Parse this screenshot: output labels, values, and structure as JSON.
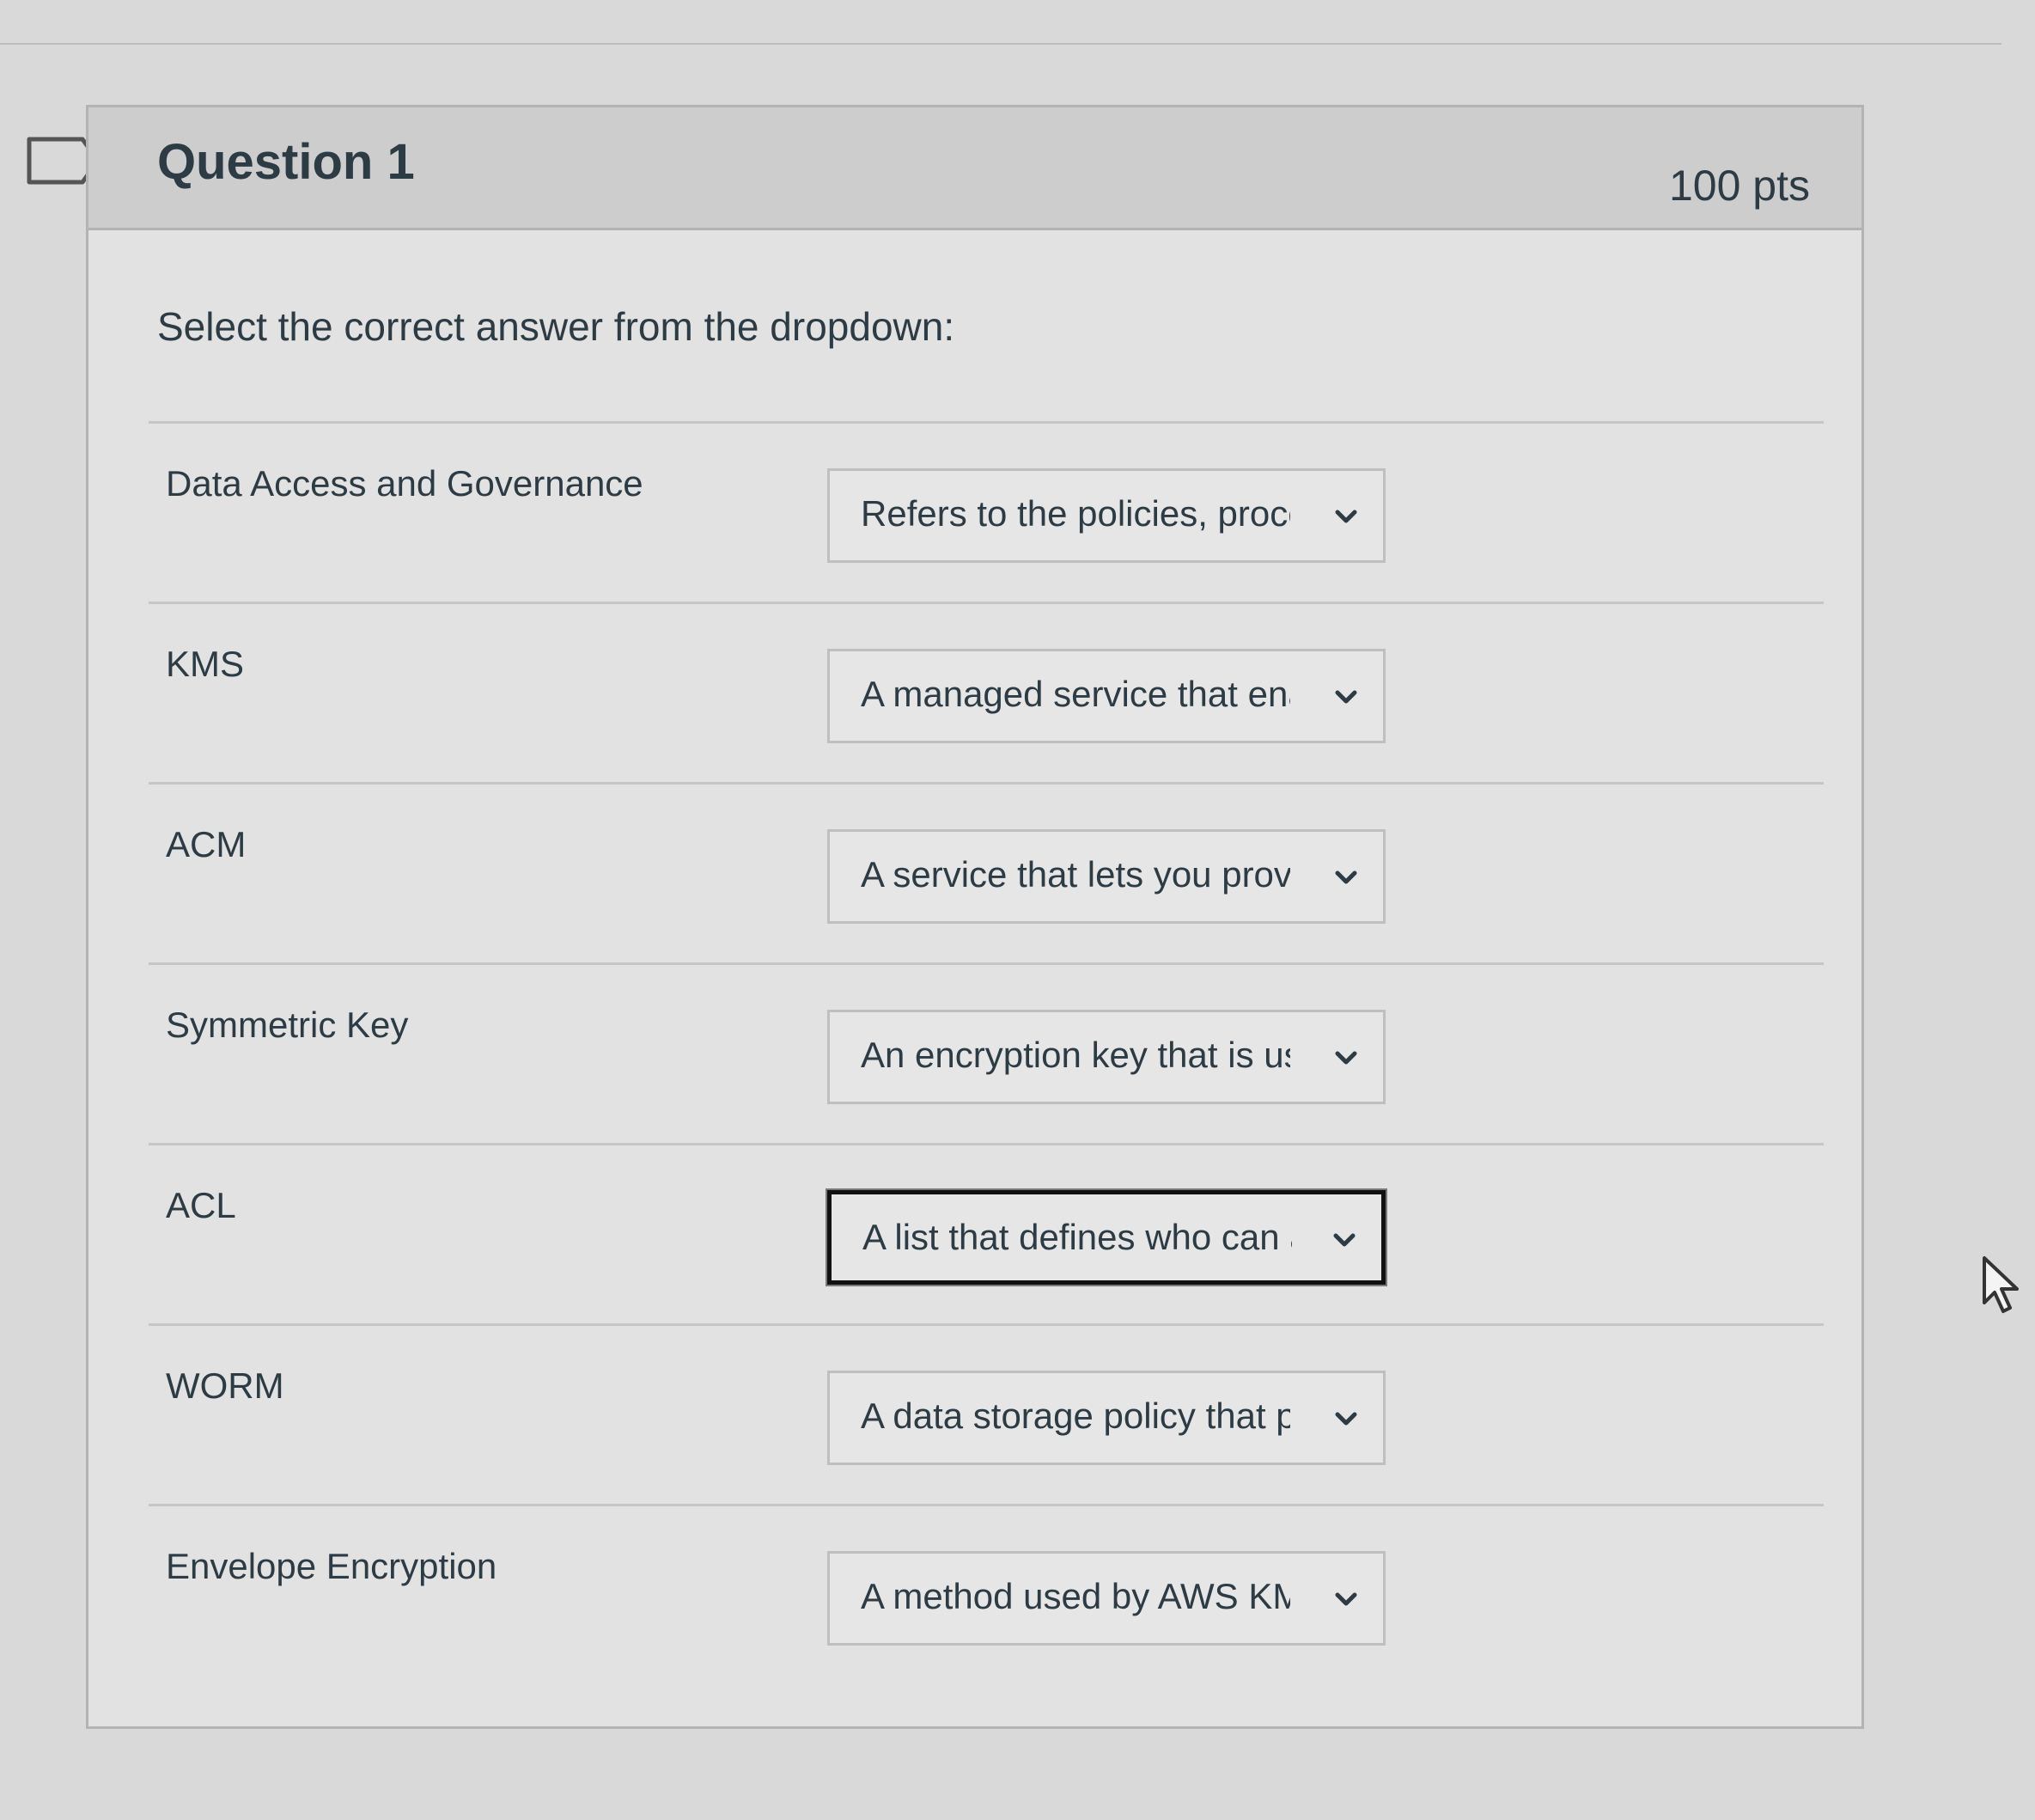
{
  "question": {
    "title": "Question 1",
    "points": "100 pts",
    "prompt": "Select the correct answer from the dropdown:"
  },
  "rows": [
    {
      "term": "Data Access and Governance",
      "selected": "Refers to the policies, procedures"
    },
    {
      "term": "KMS",
      "selected": "A managed service that enables"
    },
    {
      "term": "ACM",
      "selected": "A service that lets you provision"
    },
    {
      "term": "Symmetric Key",
      "selected": "An encryption key that is used"
    },
    {
      "term": "ACL",
      "selected": "A list that defines who can access"
    },
    {
      "term": "WORM",
      "selected": "A data storage policy that prevents"
    },
    {
      "term": "Envelope Encryption",
      "selected": "A method used by AWS KMS"
    }
  ],
  "icons": {
    "flag": "flag-question-icon",
    "chevron": "chevron-down-icon",
    "cursor": "mouse-pointer-icon"
  },
  "colors": {
    "background": "#d9d9d9",
    "card": "#e2e2e2",
    "header": "#cdcdcd",
    "text": "#2d3b45",
    "focus_border": "#111111"
  }
}
